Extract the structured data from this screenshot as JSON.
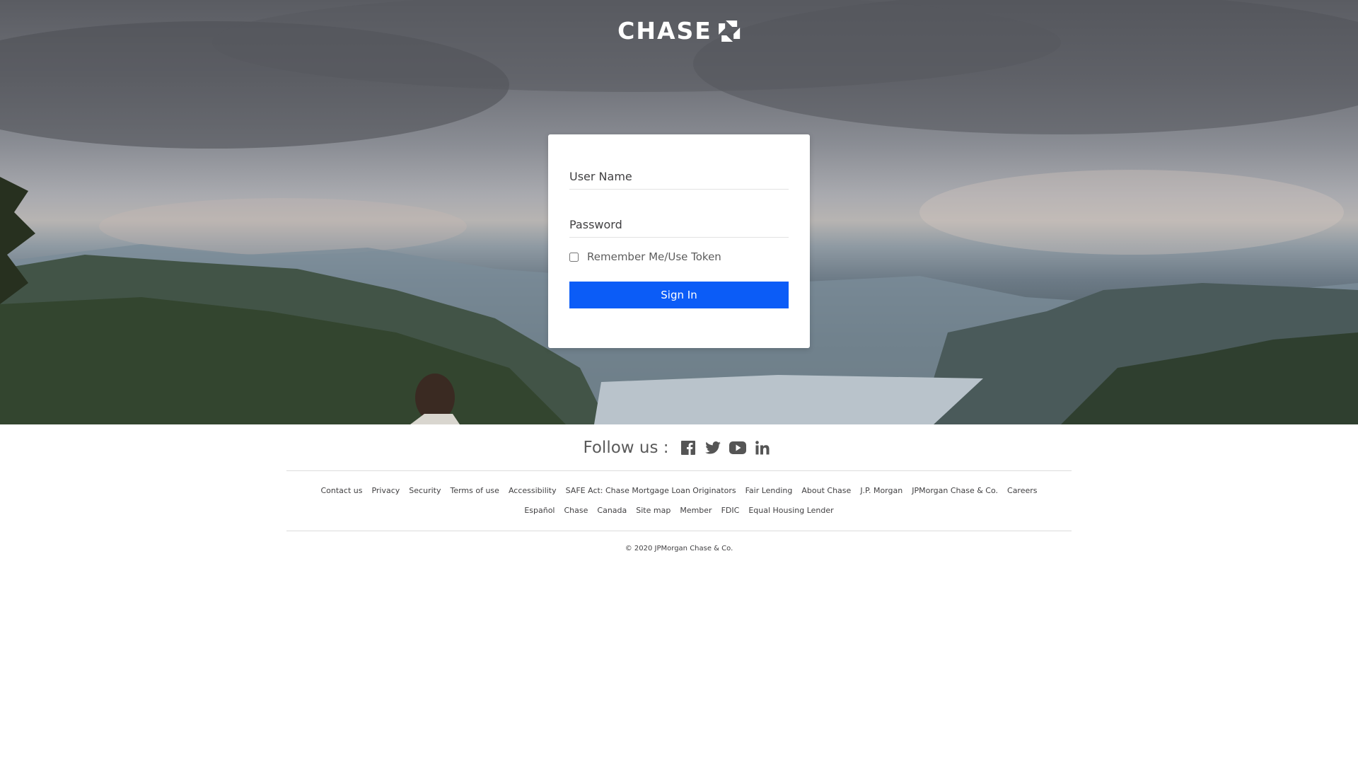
{
  "brand": {
    "name": "CHASE",
    "logo_icon": "chase-octagon-icon",
    "primary_color": "#0b5cf7"
  },
  "login": {
    "username_placeholder": "User Name",
    "password_placeholder": "Password",
    "remember_label": "Remember Me/Use Token",
    "signin_label": "Sign In"
  },
  "follow": {
    "label": "Follow us :",
    "icons": [
      "facebook-icon",
      "twitter-icon",
      "youtube-icon",
      "linkedin-icon"
    ]
  },
  "footer": {
    "row1": [
      "Contact us",
      "Privacy",
      "Security",
      "Terms of use",
      "Accessibility",
      "SAFE Act: Chase Mortgage Loan Originators",
      "Fair Lending",
      "About Chase",
      "J.P. Morgan",
      "JPMorgan Chase & Co.",
      "Careers"
    ],
    "row2": [
      "Español",
      "Chase",
      "Canada",
      "Site map",
      "Member",
      "FDIC",
      "Equal Housing Lender"
    ],
    "copyright": "© 2020 JPMorgan Chase & Co."
  }
}
